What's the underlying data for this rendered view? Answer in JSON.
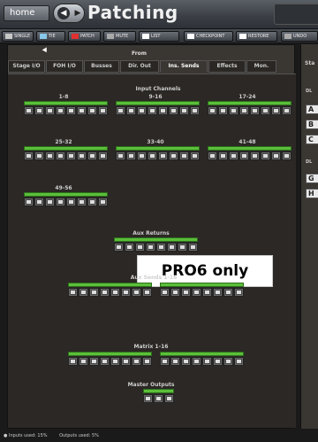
{
  "header": {
    "home_label": "home",
    "title": "Patching"
  },
  "toolbar": {
    "buttons": [
      {
        "label": "SINGLE",
        "icon": "single-patch-icon",
        "color": "#c8c8c8"
      },
      {
        "label": "TIE",
        "icon": "tie-icon",
        "color": "#88c8e8"
      },
      {
        "label": "PATCH",
        "icon": "patch-icon",
        "color": "#e03030"
      },
      {
        "label": "MUTE",
        "icon": "mute-icon",
        "color": "#aaaaaa"
      },
      {
        "label": "LIST",
        "icon": "list-icon",
        "color": "#ffffff"
      },
      {
        "label": "CHECKPOINT",
        "icon": "checkpoint-icon",
        "color": "#ffffff"
      },
      {
        "label": "RESTORE",
        "icon": "restore-icon",
        "color": "#ffffff"
      },
      {
        "label": "UNDO",
        "icon": "undo-icon",
        "color": "#aaaaaa"
      }
    ]
  },
  "panel": {
    "from_label": "From",
    "tabs": [
      {
        "label": "Stage I/O",
        "active": false
      },
      {
        "label": "FOH I/O",
        "active": false
      },
      {
        "label": "Busses",
        "active": false
      },
      {
        "label": "Dir. Out",
        "active": false
      },
      {
        "label": "Ins. Sends",
        "active": true
      },
      {
        "label": "Effects",
        "active": false
      },
      {
        "label": "Mon.",
        "active": false
      }
    ],
    "input_channels_label": "Input Channels",
    "input_groups": [
      {
        "label": "1-8",
        "count": 8
      },
      {
        "label": "9-16",
        "count": 8
      },
      {
        "label": "17-24",
        "count": 8
      },
      {
        "label": "25-32",
        "count": 8
      },
      {
        "label": "33-40",
        "count": 8
      },
      {
        "label": "41-48",
        "count": 8
      },
      {
        "label": "49-56",
        "count": 8
      }
    ],
    "pro6_label": "PRO6 only",
    "aux_returns_label": "Aux Returns",
    "aux_sends_label": "Aux Sends 1-16",
    "matrix_label": "Matrix 1-16",
    "master_outputs_label": "Master Outputs"
  },
  "right_panel": {
    "head": "Sta",
    "dl_label_1": "DL",
    "buttons_1": [
      "A",
      "B",
      "C"
    ],
    "dl_label_2": "DL",
    "buttons_2": [
      "G",
      "H"
    ]
  },
  "status": {
    "inputs_used": "Inputs used: 15%",
    "outputs_used": "Outputs used: 5%"
  }
}
